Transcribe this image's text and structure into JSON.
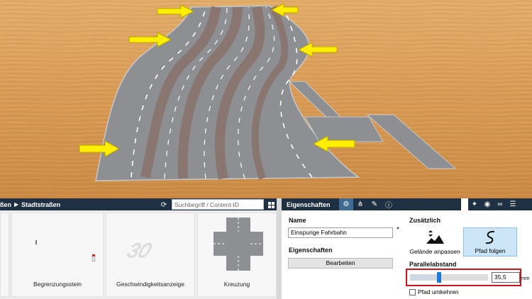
{
  "library": {
    "breadcrumb_prev": "ßen",
    "breadcrumb_current": "Stadtstraßen",
    "search_placeholder": "Suchbegriff / Content-ID",
    "items": [
      {
        "label": "Begrenzungsstein"
      },
      {
        "label": "Geschwindigkeitsanzeige"
      },
      {
        "label": "Kreuzung"
      }
    ],
    "speed_sign_text": "30"
  },
  "properties": {
    "title": "Eigenschaften",
    "name_label": "Name",
    "name_value": "Einspurige Fahrbahn",
    "name_required_mark": "*",
    "section_label": "Eigenschaften",
    "edit_button": "Bearbeiten",
    "extra_label": "Zusätzlich",
    "option_terrain": "Gelände anpassen",
    "option_path": "Pfad folgen",
    "parallel_label": "Parallelabstand",
    "parallel_value": "35,5",
    "parallel_unit": "mm",
    "parallel_fraction": 0.37,
    "reverse_label": "Pfad umkehren",
    "reverse_checked": false
  },
  "icons": {
    "refresh": "refresh-icon",
    "grid": "grid-view-icon",
    "gear": "gear-icon",
    "network": "network-icon",
    "brush": "brush-icon",
    "info": "info-icon",
    "pin": "pin-icon",
    "eye": "eye-icon",
    "link": "link-icon",
    "menu": "menu-icon"
  },
  "colors": {
    "header_bg": "#1f3042",
    "accent": "#1e78d7",
    "highlight": "#d0121b",
    "arrow": "#ffee00"
  }
}
